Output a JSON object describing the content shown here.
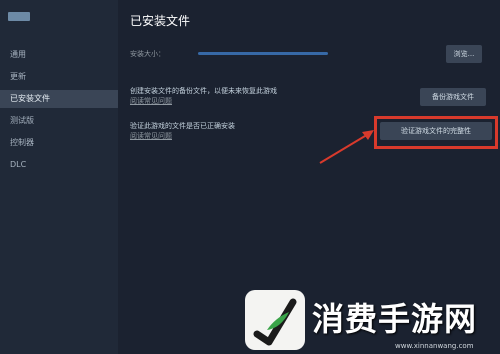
{
  "sidebar": {
    "items": [
      {
        "label": "通用"
      },
      {
        "label": "更新"
      },
      {
        "label": "已安装文件",
        "active": true
      },
      {
        "label": "测试版"
      },
      {
        "label": "控制器"
      },
      {
        "label": "DLC"
      }
    ]
  },
  "main": {
    "title": "已安装文件",
    "install_size_label": "安装大小：",
    "browse_label": "浏览...",
    "backup": {
      "text": "创建安装文件的备份文件，以便未来恢复此游戏",
      "link": "阅读常见问题",
      "button": "备份游戏文件"
    },
    "verify": {
      "text": "验证此游戏的文件是否已正确安装",
      "link": "阅读常见问题",
      "button": "验证游戏文件的完整性"
    }
  },
  "watermark": {
    "text": "消费手游网",
    "url": "www.xinnanwang.com",
    "logo_icon": "leaf-check-icon"
  },
  "colors": {
    "highlight": "#d83a2c",
    "background": "#1b2230",
    "sidebar": "#202938"
  }
}
